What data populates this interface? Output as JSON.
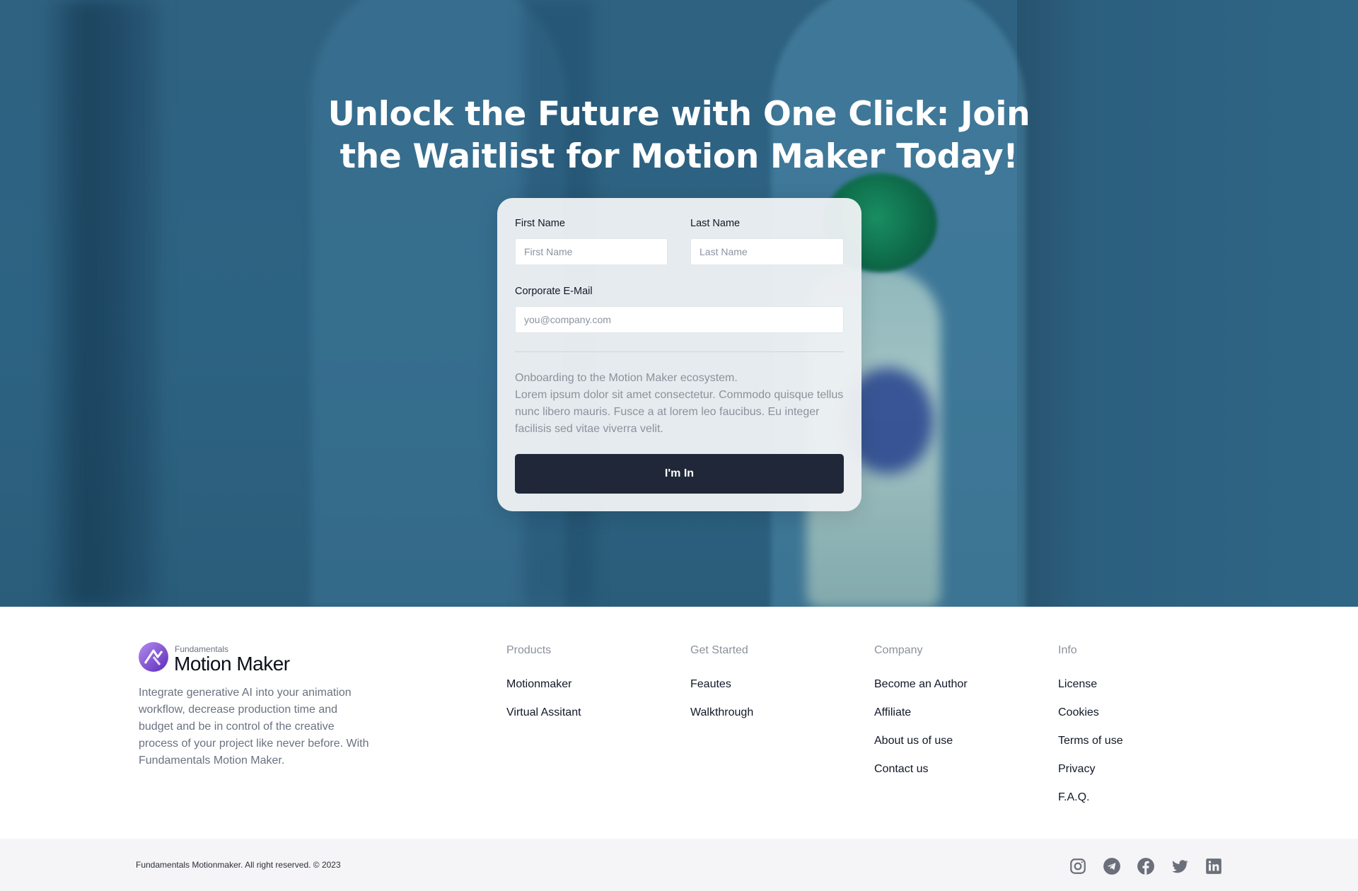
{
  "hero": {
    "title": "Unlock the Future with One Click: Join the Waitlist for Motion Maker Today!"
  },
  "form": {
    "first_name_label": "First Name",
    "first_name_placeholder": "First Name",
    "last_name_label": "Last Name",
    "last_name_placeholder": "Last Name",
    "email_label": "Corporate E-Mail",
    "email_placeholder": "you@company.com",
    "description_line1": "Onboarding to the Motion Maker ecosystem.",
    "description_line2": "Lorem ipsum dolor sit amet consectetur. Commodo quisque tellus nunc libero mauris. Fusce a at lorem leo faucibus. Eu integer facilisis sed vitae viverra velit.",
    "submit_label": "I'm In"
  },
  "brand": {
    "small": "Fundamentals",
    "name": "Motion Maker",
    "about": "Integrate generative AI into your animation workflow, decrease production time and budget and be in control of the creative process of your project like never before. With Fundamentals Motion Maker."
  },
  "footer": {
    "columns": [
      {
        "title": "Products",
        "links": [
          "Motionmaker",
          "Virtual Assitant"
        ]
      },
      {
        "title": "Get Started",
        "links": [
          "Feautes",
          "Walkthrough"
        ]
      },
      {
        "title": "Company",
        "links": [
          "Become an Author",
          "Affiliate",
          "About us of use",
          "Contact us"
        ]
      },
      {
        "title": "Info",
        "links": [
          "License",
          "Cookies",
          "Terms of use",
          "Privacy",
          "F.A.Q."
        ]
      }
    ],
    "copyright": "Fundamentals Motionmaker. All right reserved. © 2023",
    "socials": [
      "instagram-icon",
      "telegram-icon",
      "facebook-icon",
      "twitter-icon",
      "linkedin-icon"
    ]
  },
  "colors": {
    "hero_bg": "#2f6281",
    "button_bg": "#1f2738",
    "brand_purple": "#7c4fd6"
  }
}
